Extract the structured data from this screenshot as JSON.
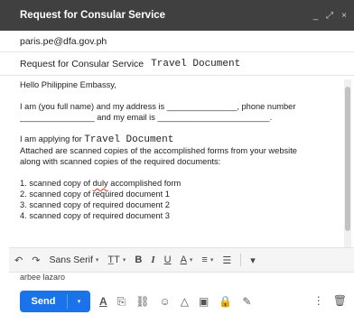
{
  "window": {
    "title": "Request for Consular Service",
    "controls": [
      "_",
      "⤢",
      "×"
    ]
  },
  "to": "paris.pe@dfa.gov.ph",
  "subject": {
    "text": "Request for Consular Service",
    "tag": "Travel Document"
  },
  "body": {
    "greeting": "Hello Philippine Embassy,",
    "intro1": "I am (you full name) and my address is _______________, phone number",
    "intro2": "________________ and my email is ________________________.",
    "applying_prefix": "I am applying for",
    "applying_value": "Travel Document",
    "attached1": "Attached are scanned copies of the accomplished forms from your website",
    "attached2": "along with scanned copies of the required documents:",
    "list": {
      "item1_prefix": "1. scanned copy of ",
      "item1_word": "duly",
      "item1_suffix": " accomplished form",
      "item2": "2. scanned copy of required document 1",
      "item3": "3. scanned copy of required document 2",
      "item4": "4. scanned copy of required document 3"
    },
    "signature": "arbee lazaro"
  },
  "format_toolbar": {
    "undo": "↶",
    "redo": "↷",
    "font": "Sans Serif",
    "font_size": "T̲T",
    "bold": "B",
    "italic": "I",
    "underline": "U",
    "text_color": "A",
    "align": "≡",
    "list": "☰",
    "more": "▾",
    "caret": "▾"
  },
  "bottom": {
    "send_label": "Send",
    "send_options": "▾",
    "icons": [
      "A",
      "⎘",
      "⛓",
      "☺",
      "△",
      "▣",
      "🔒",
      "✎"
    ],
    "more": "⋮",
    "trash": "🗑"
  }
}
